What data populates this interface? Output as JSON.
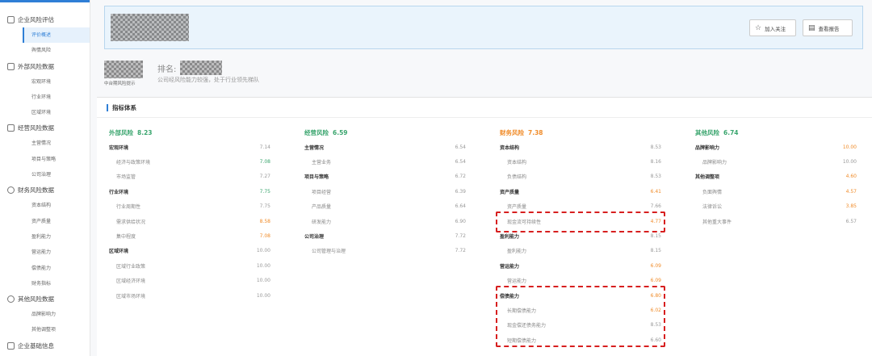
{
  "sidebar": {
    "groups": [
      {
        "label": "企业风险评估",
        "icon": "shield-check-icon",
        "items": [
          "评价概述",
          "舆情风险"
        ]
      },
      {
        "label": "外部风险数据",
        "icon": "document-icon",
        "items": [
          "宏观环境",
          "行业环境",
          "区域环境"
        ]
      },
      {
        "label": "经营风险数据",
        "icon": "briefcase-icon",
        "items": [
          "主营情况",
          "项目与策略",
          "公司治理"
        ]
      },
      {
        "label": "财务风险数据",
        "icon": "finance-icon",
        "items": [
          "资本结构",
          "资产质量",
          "盈利能力",
          "营运能力",
          "偿债能力",
          "财务指标"
        ]
      },
      {
        "label": "其他风险数据",
        "icon": "clock-icon",
        "items": [
          "品牌影响力",
          "其他调整项"
        ]
      },
      {
        "label": "企业基础信息",
        "icon": "info-icon",
        "items": []
      }
    ],
    "active": "评价概述"
  },
  "header": {
    "follow_btn": "加入关注",
    "report_btn": "查看报告"
  },
  "rank": {
    "caption": "中台期风险提示",
    "label": "排名:",
    "subtitle": "公司经风险能力较强，处于行业领先梯队"
  },
  "panel": {
    "title": "指标体系"
  },
  "colors": {
    "green": "#3aa56e",
    "orange": "#f08c2a",
    "blue": "#2f7fd6",
    "highlight": "#d71f1f"
  },
  "columns": [
    {
      "name": "外部风险",
      "score": "8.23",
      "score_color": "green",
      "rows": [
        {
          "label": "宏观环境",
          "value": "7.14",
          "level": 2,
          "color": "gray"
        },
        {
          "label": "经济与政策环境",
          "value": "7.08",
          "level": 3,
          "color": "green"
        },
        {
          "label": "市场监管",
          "value": "7.27",
          "level": 3,
          "color": "gray"
        },
        {
          "label": "行业环境",
          "value": "7.75",
          "level": 2,
          "color": "green"
        },
        {
          "label": "行业周期性",
          "value": "7.75",
          "level": 3,
          "color": "gray"
        },
        {
          "label": "需求供给状况",
          "value": "8.58",
          "level": 3,
          "color": "orange"
        },
        {
          "label": "集中程度",
          "value": "7.08",
          "level": 3,
          "color": "orange"
        },
        {
          "label": "区域环境",
          "value": "10.00",
          "level": 2,
          "color": "gray"
        },
        {
          "label": "区域行业政策",
          "value": "10.00",
          "level": 3,
          "color": "gray"
        },
        {
          "label": "区域经济环境",
          "value": "10.00",
          "level": 3,
          "color": "gray"
        },
        {
          "label": "区域市场环境",
          "value": "10.00",
          "level": 3,
          "color": "gray"
        }
      ]
    },
    {
      "name": "经营风险",
      "score": "6.59",
      "score_color": "green",
      "rows": [
        {
          "label": "主营情况",
          "value": "6.54",
          "level": 2,
          "color": "gray"
        },
        {
          "label": "主营业务",
          "value": "6.54",
          "level": 3,
          "color": "gray"
        },
        {
          "label": "项目与策略",
          "value": "6.72",
          "level": 2,
          "color": "gray"
        },
        {
          "label": "项目经营",
          "value": "6.39",
          "level": 3,
          "color": "gray"
        },
        {
          "label": "产品质量",
          "value": "6.64",
          "level": 3,
          "color": "gray"
        },
        {
          "label": "研发能力",
          "value": "6.90",
          "level": 3,
          "color": "gray"
        },
        {
          "label": "公司治理",
          "value": "7.72",
          "level": 2,
          "color": "gray"
        },
        {
          "label": "公司管理与治理",
          "value": "7.72",
          "level": 3,
          "color": "gray"
        }
      ]
    },
    {
      "name": "财务风险",
      "score": "7.38",
      "score_color": "orange",
      "rows": [
        {
          "label": "资本结构",
          "value": "8.53",
          "level": 2,
          "color": "gray"
        },
        {
          "label": "资本结构",
          "value": "8.16",
          "level": 3,
          "color": "gray"
        },
        {
          "label": "负债结构",
          "value": "8.53",
          "level": 3,
          "color": "gray"
        },
        {
          "label": "资产质量",
          "value": "6.41",
          "level": 2,
          "color": "orange"
        },
        {
          "label": "资产质量",
          "value": "7.66",
          "level": 3,
          "color": "gray"
        },
        {
          "label": "现金流可持续性",
          "value": "4.77",
          "level": 3,
          "color": "orange"
        },
        {
          "label": "盈利能力",
          "value": "8.15",
          "level": 2,
          "color": "gray"
        },
        {
          "label": "盈利能力",
          "value": "8.15",
          "level": 3,
          "color": "gray"
        },
        {
          "label": "营运能力",
          "value": "6.09",
          "level": 2,
          "color": "orange"
        },
        {
          "label": "营运能力",
          "value": "6.09",
          "level": 3,
          "color": "orange"
        },
        {
          "label": "偿债能力",
          "value": "6.80",
          "level": 2,
          "color": "orange"
        },
        {
          "label": "长期偿债能力",
          "value": "6.02",
          "level": 3,
          "color": "orange"
        },
        {
          "label": "现金偿还债务能力",
          "value": "8.53",
          "level": 3,
          "color": "gray"
        },
        {
          "label": "短期偿债能力",
          "value": "6.60",
          "level": 3,
          "color": "gray"
        }
      ]
    },
    {
      "name": "其他风险",
      "score": "6.74",
      "score_color": "green",
      "rows": [
        {
          "label": "品牌影响力",
          "value": "10.00",
          "level": 2,
          "color": "orange"
        },
        {
          "label": "品牌影响力",
          "value": "10.00",
          "level": 3,
          "color": "gray"
        },
        {
          "label": "其他调整项",
          "value": "4.60",
          "level": 2,
          "color": "orange"
        },
        {
          "label": "负面舆情",
          "value": "4.57",
          "level": 3,
          "color": "orange"
        },
        {
          "label": "法律诉讼",
          "value": "3.85",
          "level": 3,
          "color": "orange"
        },
        {
          "label": "其他重大事件",
          "value": "6.57",
          "level": 3,
          "color": "gray"
        }
      ]
    }
  ]
}
